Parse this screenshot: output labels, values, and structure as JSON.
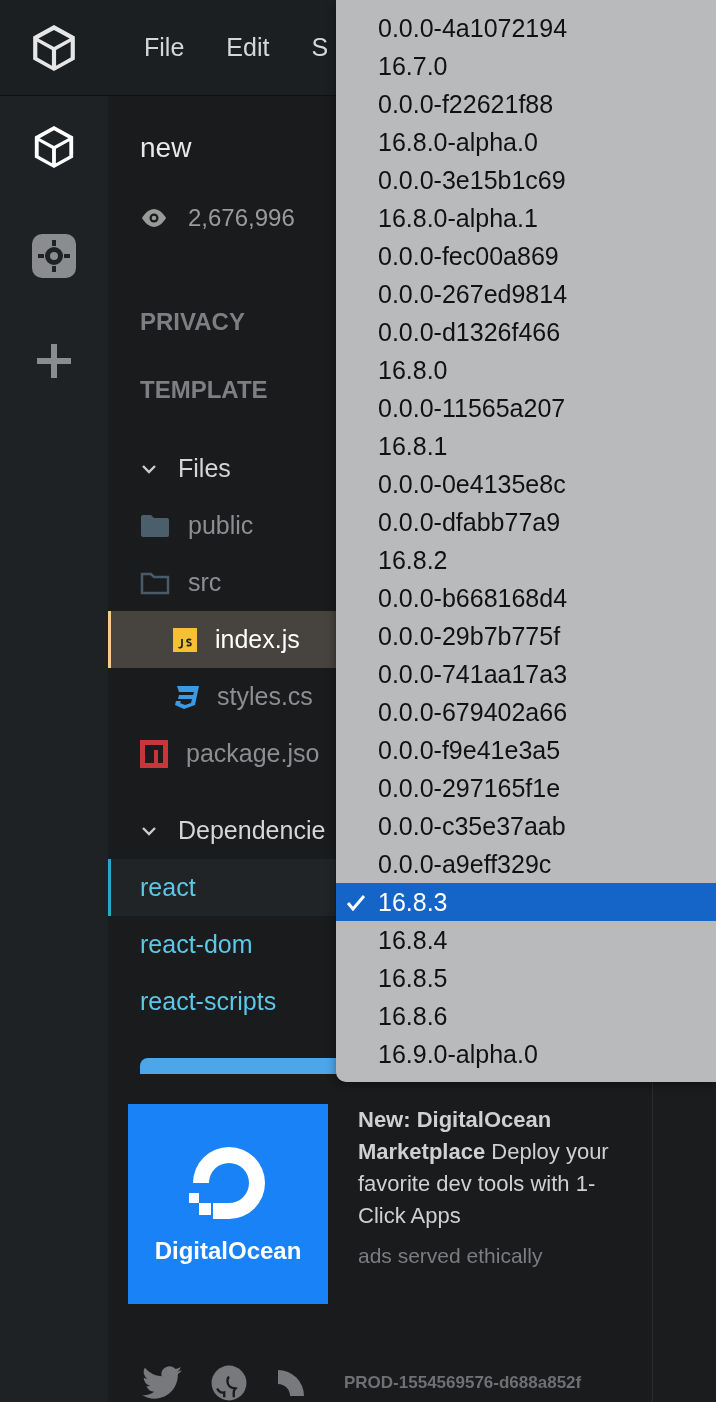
{
  "menu": [
    "File",
    "Edit",
    "S"
  ],
  "sandbox": {
    "title": "new",
    "views": "2,676,996"
  },
  "sections": [
    "PRIVACY",
    "TEMPLATE"
  ],
  "files": {
    "label": "Files",
    "expanded": true,
    "items": [
      {
        "name": "public",
        "kind": "folder",
        "expanded": false,
        "selected": false
      },
      {
        "name": "src",
        "kind": "folder",
        "expanded": true,
        "selected": false,
        "children": [
          {
            "name": "index.js",
            "kind": "js",
            "selected": true
          },
          {
            "name": "styles.cs",
            "kind": "css",
            "selected": false
          }
        ]
      },
      {
        "name": "package.jso",
        "kind": "npm",
        "selected": false
      }
    ]
  },
  "dependencies": {
    "label": "Dependencie",
    "expanded": true,
    "items": [
      {
        "name": "react",
        "selected": true
      },
      {
        "name": "react-dom",
        "selected": false
      },
      {
        "name": "react-scripts",
        "selected": false
      }
    ]
  },
  "version_menu": [
    {
      "label": "0.0.0-4a1072194",
      "selected": false
    },
    {
      "label": "16.7.0",
      "selected": false
    },
    {
      "label": "0.0.0-f22621f88",
      "selected": false
    },
    {
      "label": "16.8.0-alpha.0",
      "selected": false
    },
    {
      "label": "0.0.0-3e15b1c69",
      "selected": false
    },
    {
      "label": "16.8.0-alpha.1",
      "selected": false
    },
    {
      "label": "0.0.0-fec00a869",
      "selected": false
    },
    {
      "label": "0.0.0-267ed9814",
      "selected": false
    },
    {
      "label": "0.0.0-d1326f466",
      "selected": false
    },
    {
      "label": "16.8.0",
      "selected": false
    },
    {
      "label": "0.0.0-11565a207",
      "selected": false
    },
    {
      "label": "16.8.1",
      "selected": false
    },
    {
      "label": "0.0.0-0e4135e8c",
      "selected": false
    },
    {
      "label": "0.0.0-dfabb77a9",
      "selected": false
    },
    {
      "label": "16.8.2",
      "selected": false
    },
    {
      "label": "0.0.0-b668168d4",
      "selected": false
    },
    {
      "label": "0.0.0-29b7b775f",
      "selected": false
    },
    {
      "label": "0.0.0-741aa17a3",
      "selected": false
    },
    {
      "label": "0.0.0-679402a66",
      "selected": false
    },
    {
      "label": "0.0.0-f9e41e3a5",
      "selected": false
    },
    {
      "label": "0.0.0-297165f1e",
      "selected": false
    },
    {
      "label": "0.0.0-c35e37aab",
      "selected": false
    },
    {
      "label": "0.0.0-a9eff329c",
      "selected": false
    },
    {
      "label": "16.8.3",
      "selected": true
    },
    {
      "label": "16.8.4",
      "selected": false
    },
    {
      "label": "16.8.5",
      "selected": false
    },
    {
      "label": "16.8.6",
      "selected": false
    },
    {
      "label": "16.9.0-alpha.0",
      "selected": false
    }
  ],
  "ad": {
    "logo_text": "DigitalOcean",
    "text": "**New: DigitalOcean Marketplace** Deploy your favorite dev tools with 1-Click Apps",
    "note": "ads served ethically"
  },
  "build": "PROD-1554569576-d688a852f"
}
